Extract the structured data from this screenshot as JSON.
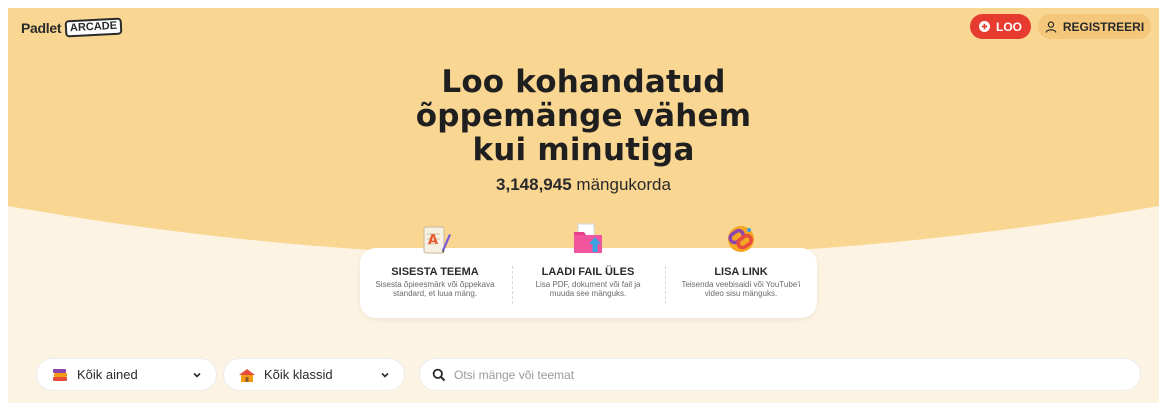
{
  "header": {
    "logo_word": "Padlet",
    "logo_badge": "ARCADE",
    "create_label": "LOO",
    "register_label": "REGISTREERI"
  },
  "hero": {
    "title_line1": "Loo kohandatud",
    "title_line2": "õppemänge vähem",
    "title_line3": "kui minutiga",
    "play_count": "3,148,945",
    "play_count_suffix": "mängukorda"
  },
  "options": [
    {
      "title": "SISESTA TEEMA",
      "description": "Sisesta õpieesmärk või õppekava standard, et luua mäng.",
      "icon": "writing-pad-icon"
    },
    {
      "title": "LAADI FAIL ÜLES",
      "description": "Lisa PDF, dokument või fail ja muuda see mänguks.",
      "icon": "upload-folder-icon"
    },
    {
      "title": "LISA LINK",
      "description": "Teisenda veebisaidi või YouTube'i video sisu mänguks.",
      "icon": "link-chain-icon"
    }
  ],
  "filters": {
    "subjects_label": "Kõik ained",
    "grades_label": "Kõik klassid",
    "search_placeholder": "Otsi mänge või teemat"
  },
  "colors": {
    "hero_background": "#f9d692",
    "page_background": "#fdf3e3",
    "create_button": "#e63b2e",
    "register_button": "#f4c77a"
  }
}
